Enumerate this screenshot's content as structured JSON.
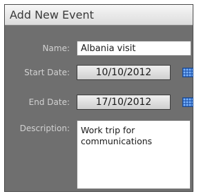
{
  "dialog": {
    "title": "Add New Event",
    "fields": {
      "name": {
        "label": "Name:",
        "value": "Albania visit"
      },
      "start_date": {
        "label": "Start Date:",
        "value": "10/10/2012"
      },
      "end_date": {
        "label": "End Date:",
        "value": "17/10/2012"
      },
      "description": {
        "label": "Description:",
        "value": "Work trip for\ncommunications"
      }
    },
    "icons": {
      "calendar": "calendar-icon"
    },
    "colors": {
      "panel": "#6f6f6f",
      "label": "#d2d2d2",
      "calendar": "#2a61b8"
    }
  }
}
